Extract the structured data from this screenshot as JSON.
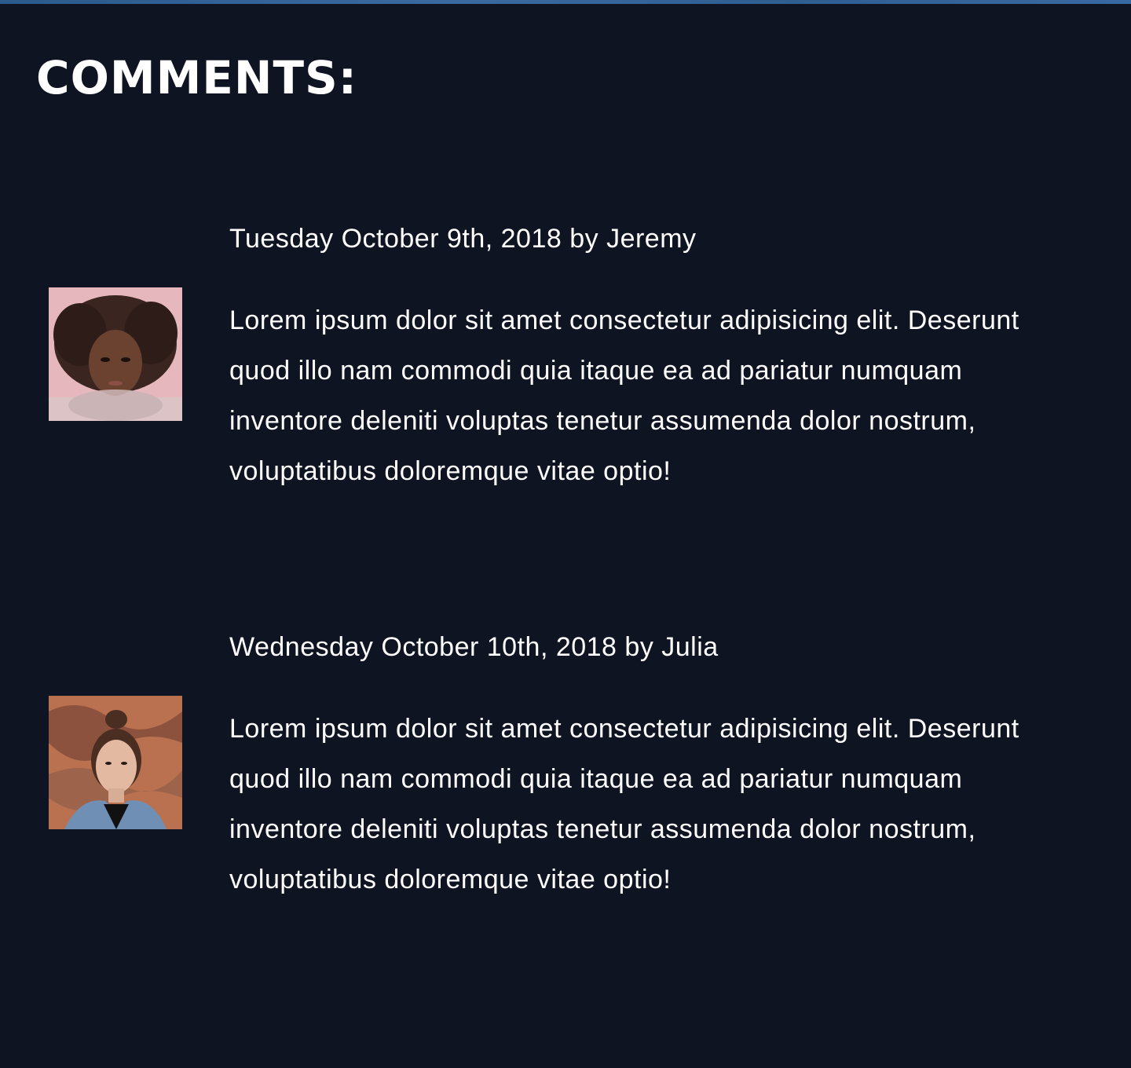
{
  "page": {
    "heading": "COMMENTS:"
  },
  "comments": [
    {
      "meta": "Tuesday October 9th, 2018 by Jeremy",
      "text": "Lorem ipsum dolor sit amet consectetur adipisicing elit. Deserunt quod illo nam commodi quia itaque ea ad pariatur numquam inventore deleniti voluptas tenetur assumenda dolor nostrum, voluptatibus doloremque vitae optio!"
    },
    {
      "meta": "Wednesday October 10th, 2018 by Julia",
      "text": "Lorem ipsum dolor sit amet consectetur adipisicing elit. Deserunt quod illo nam commodi quia itaque ea ad pariatur numquam inventore deleniti voluptas tenetur assumenda dolor nostrum, voluptatibus doloremque vitae optio!"
    }
  ],
  "colors": {
    "background": "#0f1423",
    "text": "#ffffff",
    "accent_strip": "#2f5f91"
  }
}
